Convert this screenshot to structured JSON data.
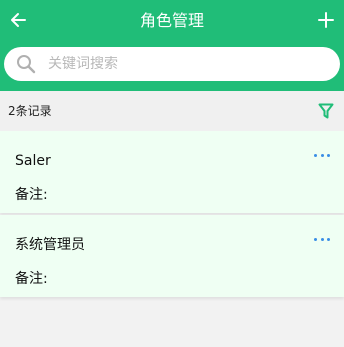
{
  "header": {
    "title": "角色管理",
    "back_icon": "arrow-left-icon",
    "add_icon": "plus-icon",
    "color": "#20bd78"
  },
  "search": {
    "placeholder": "关键词搜索",
    "value": "",
    "icon": "search-icon"
  },
  "list_info": {
    "count_text": "2条记录",
    "filter_icon": "filter-icon",
    "filter_color": "#20bd78"
  },
  "roles": [
    {
      "name": "Saler",
      "note_label": "备注:",
      "note_value": "",
      "more_icon": "more-dots-icon"
    },
    {
      "name": "系统管理员",
      "note_label": "备注:",
      "note_value": "",
      "more_icon": "more-dots-icon"
    }
  ],
  "colors": {
    "card_bg": "#effff3",
    "page_bg": "#f2f2f2",
    "more_dots": "#3a8ee6"
  }
}
